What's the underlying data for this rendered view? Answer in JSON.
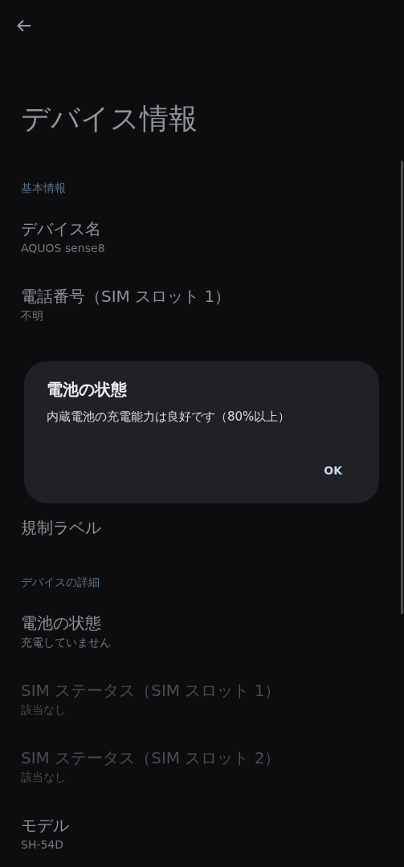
{
  "title": "デバイス情報",
  "sections": [
    {
      "header": "基本情報",
      "items": [
        {
          "title": "デバイス名",
          "summary": "AQUOS sense8",
          "disabled": false
        },
        {
          "title": "電話番号（SIM スロット 1）",
          "summary": "不明",
          "disabled": false
        }
      ]
    },
    {
      "items": [
        {
          "title": "規制ラベル",
          "disabled": false
        }
      ]
    },
    {
      "header": "デバイスの詳細",
      "items": [
        {
          "title": "電池の状態",
          "summary": "充電していません",
          "disabled": false
        },
        {
          "title": "SIM ステータス（SIM スロット 1）",
          "summary": "該当なし",
          "disabled": true
        },
        {
          "title": "SIM ステータス（SIM スロット 2）",
          "summary": "該当なし",
          "disabled": true
        },
        {
          "title": "モデル",
          "summary": "SH-54D",
          "disabled": false
        }
      ]
    }
  ],
  "dialog": {
    "title": "電池の状態",
    "message": "内蔵電池の充電能力は良好です（80%以上）",
    "buttons": [
      "OK"
    ]
  }
}
